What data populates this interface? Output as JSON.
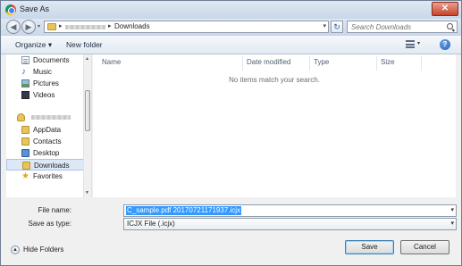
{
  "window": {
    "title": "Save As",
    "close": "✕"
  },
  "address": {
    "crumb": "Downloads",
    "arrow1": "▸",
    "arrow2": "▸",
    "drop": "▾",
    "refresh": "↻"
  },
  "search": {
    "placeholder": "Search Downloads"
  },
  "nav_buttons": {
    "back": "◀",
    "forward": "▶",
    "recent": "▾"
  },
  "toolbar": {
    "organize": "Organize ▾",
    "new_folder": "New folder",
    "view_drop": "▾",
    "help": "?"
  },
  "sidebar": {
    "items": [
      {
        "label": "Documents"
      },
      {
        "label": "Music"
      },
      {
        "label": "Pictures"
      },
      {
        "label": "Videos"
      },
      {
        "label": "AppData"
      },
      {
        "label": "Contacts"
      },
      {
        "label": "Desktop"
      },
      {
        "label": "Downloads"
      },
      {
        "label": "Favorites"
      }
    ],
    "selected": "Downloads",
    "scroll_up": "▲",
    "scroll_down": "▼"
  },
  "file_list": {
    "columns": [
      "Name",
      "Date modified",
      "Type",
      "Size"
    ],
    "empty_message": "No items match your search."
  },
  "form": {
    "file_name_label": "File name:",
    "file_name_value": "C_sample.pdf 20170721171937.icjx",
    "save_type_label": "Save as type:",
    "save_type_value": "ICJX File (.icjx)",
    "drop": "▾"
  },
  "footer": {
    "hide_folders": "Hide Folders",
    "hide_icon": "▲",
    "save": "Save",
    "cancel": "Cancel"
  },
  "colors": {
    "selection": "#3399ff",
    "title_gradient": "#c9d7e8",
    "close": "#c7432a"
  }
}
